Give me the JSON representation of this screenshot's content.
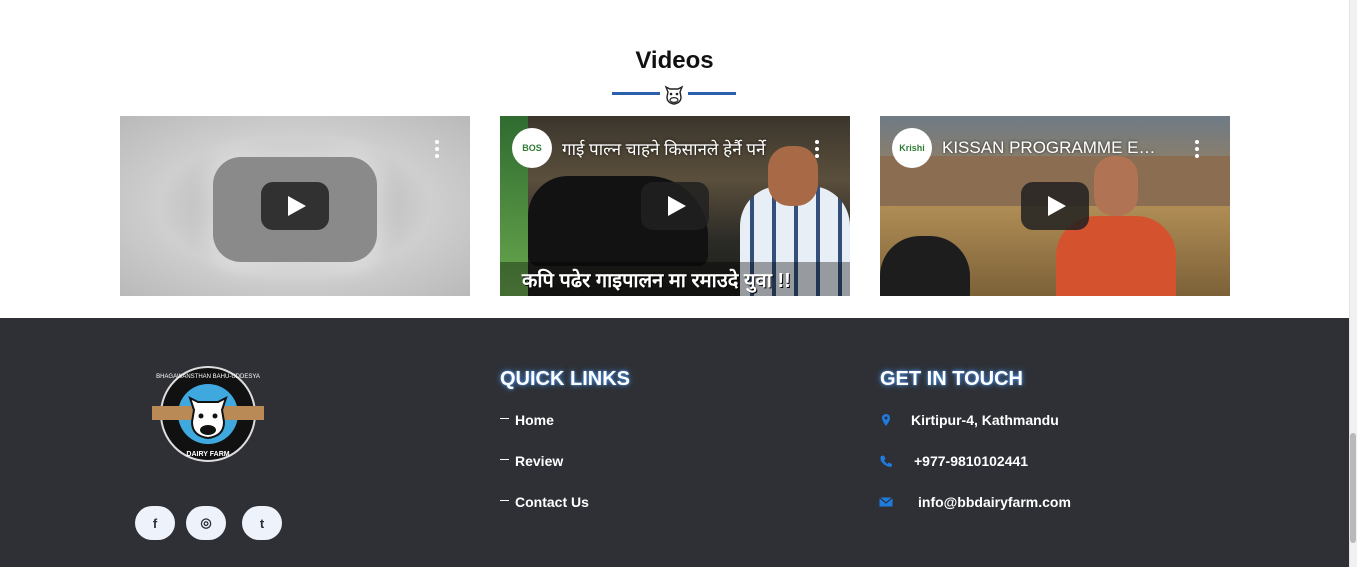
{
  "videos_section": {
    "title": "Videos",
    "videos": [
      {
        "title": "",
        "caption": ""
      },
      {
        "title": "गाई पाल्न चाहने किसानले हेर्नै पर्ने",
        "channel_logo_text": "BOS",
        "caption": "कपि पढेर गाइपालन मा रमाउदे युवा !!"
      },
      {
        "title": "KISSAN PROGRAMME EPISODE",
        "channel_logo_text": "Krishi"
      }
    ]
  },
  "footer": {
    "logo_text_top": "BHAGAWANSTHAN BAHU-UDDESYA",
    "logo_text_bottom": "DAIRY FARM",
    "social": {
      "facebook": "f",
      "instagram": "◎",
      "twitter": "t"
    },
    "quick_links": {
      "heading": "QUICK LINKS",
      "items": [
        "Home",
        "Review",
        "Contact Us"
      ]
    },
    "get_in_touch": {
      "heading": "GET IN TOUCH",
      "address": "Kirtipur-4, Kathmandu",
      "phone": "+977-9810102441",
      "email": "info@bbdairyfarm.com"
    }
  },
  "colors": {
    "footer_bg": "#2e3035",
    "accent_blue": "#2b5fab",
    "icon_blue": "#1e7be0"
  }
}
